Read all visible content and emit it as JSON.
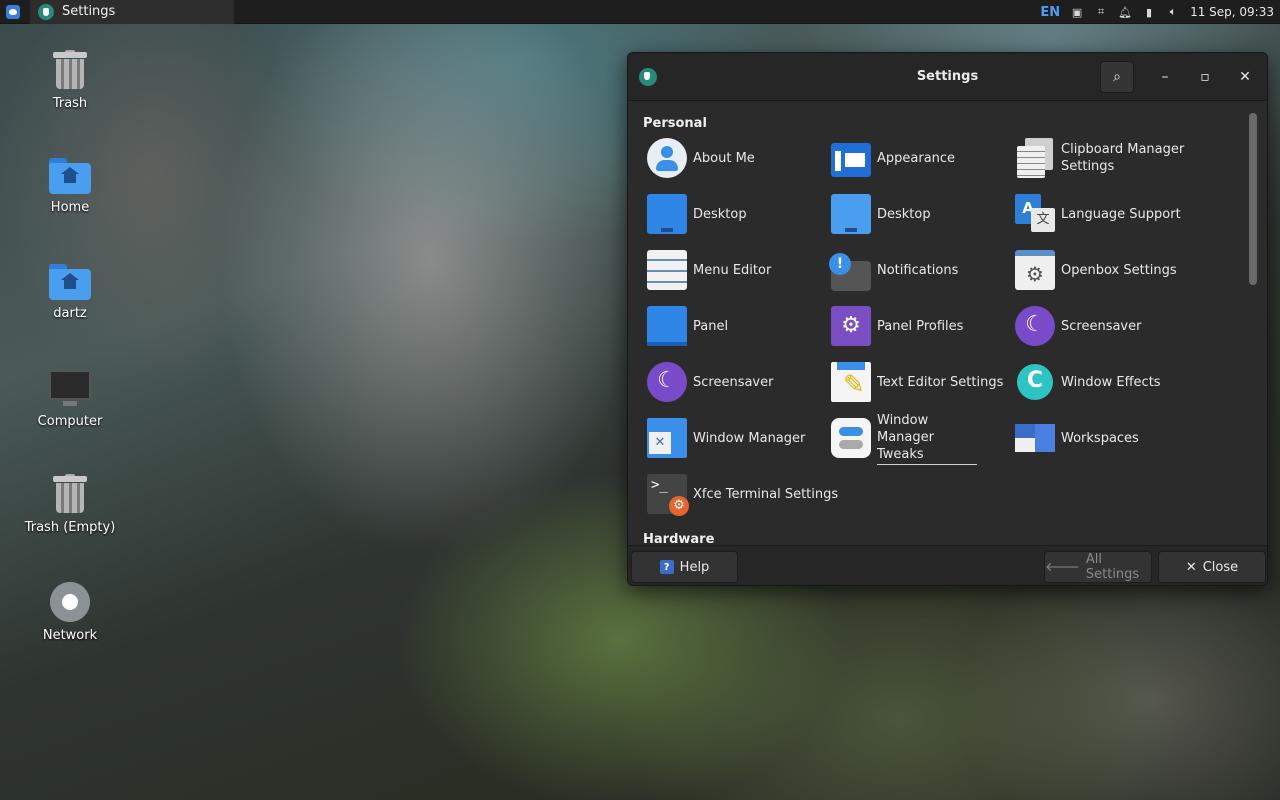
{
  "top_panel": {
    "task_title": "Settings",
    "keyboard_layout": "EN",
    "clock": "11 Sep, 09:33"
  },
  "desktop_icons": [
    {
      "label": "Trash"
    },
    {
      "label": "Home"
    },
    {
      "label": "dartz"
    },
    {
      "label": "Computer"
    },
    {
      "label": "Trash (Empty)"
    },
    {
      "label": "Network"
    }
  ],
  "window": {
    "title": "Settings",
    "sections": [
      {
        "label": "Personal"
      },
      {
        "label": "Hardware"
      }
    ],
    "items": [
      {
        "label": "About Me",
        "icon": "about-me-icon"
      },
      {
        "label": "Appearance",
        "icon": "appearance-icon"
      },
      {
        "label": "Clipboard Manager Settings",
        "icon": "clipboard-icon"
      },
      {
        "label": "Desktop",
        "icon": "desktop-icon"
      },
      {
        "label": "Desktop",
        "icon": "desktop-icon"
      },
      {
        "label": "Language Support",
        "icon": "language-icon"
      },
      {
        "label": "Menu Editor",
        "icon": "menu-editor-icon"
      },
      {
        "label": "Notifications",
        "icon": "notifications-icon"
      },
      {
        "label": "Openbox Settings",
        "icon": "openbox-icon"
      },
      {
        "label": "Panel",
        "icon": "panel-icon"
      },
      {
        "label": "Panel Profiles",
        "icon": "panel-profiles-icon"
      },
      {
        "label": "Screensaver",
        "icon": "screensaver-icon"
      },
      {
        "label": "Screensaver",
        "icon": "screensaver-icon"
      },
      {
        "label": "Text Editor Settings",
        "icon": "text-editor-icon"
      },
      {
        "label": "Window Effects",
        "icon": "window-effects-icon"
      },
      {
        "label": "Window Manager",
        "icon": "window-manager-icon"
      },
      {
        "label": "Window Manager Tweaks",
        "icon": "tweaks-icon"
      },
      {
        "label": "Workspaces",
        "icon": "workspaces-icon"
      },
      {
        "label": "Xfce Terminal Settings",
        "icon": "terminal-icon"
      }
    ],
    "footer": {
      "help_label": "Help",
      "all_settings_label": "All Settings",
      "close_label": "Close"
    }
  }
}
